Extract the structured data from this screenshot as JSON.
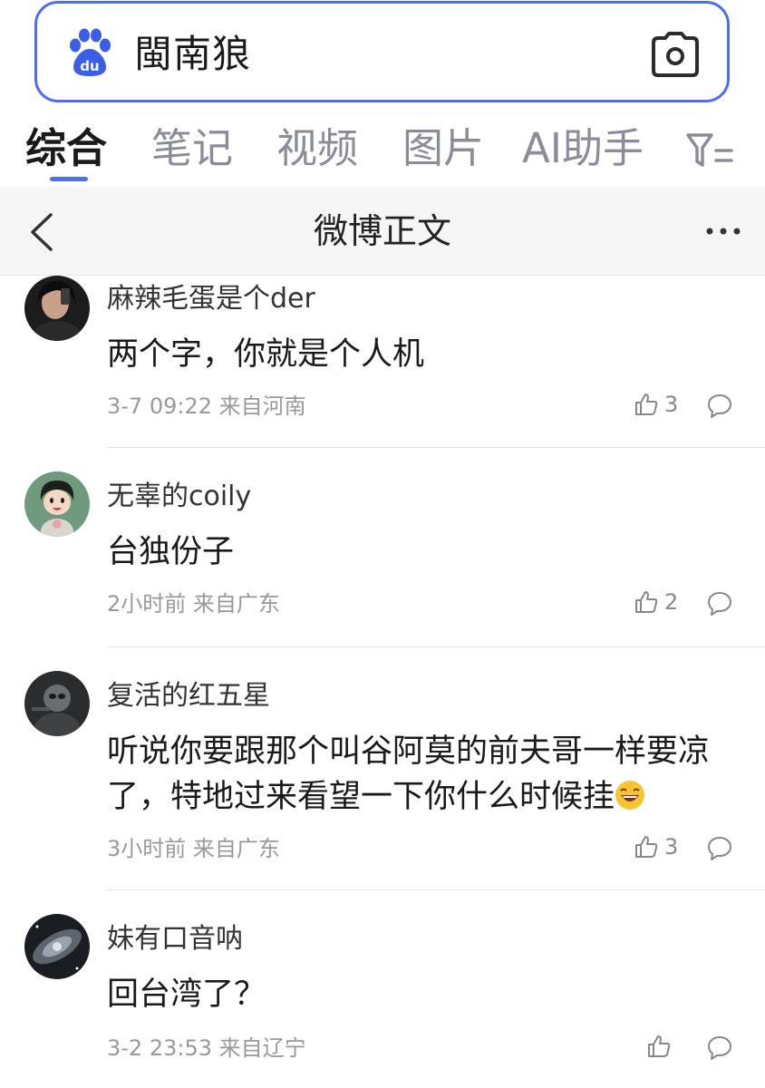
{
  "search": {
    "query": "閩南狼",
    "logo_icon": "baidu-paw-icon",
    "camera_icon": "camera-icon"
  },
  "tabs": [
    {
      "label": "综合",
      "active": true
    },
    {
      "label": "笔记",
      "active": false
    },
    {
      "label": "视频",
      "active": false
    },
    {
      "label": "图片",
      "active": false
    },
    {
      "label": "AI助手",
      "active": false
    }
  ],
  "header": {
    "title": "微博正文",
    "back_icon": "chevron-left-icon",
    "more_icon": "more-dots-icon"
  },
  "comments": [
    {
      "author": "麻辣毛蛋是个der",
      "text": "两个字，你就是个人机",
      "meta": "3-7 09:22 来自河南",
      "likes": "3"
    },
    {
      "author": "无辜的coily",
      "text": "台独份子",
      "meta": "2小时前 来自广东",
      "likes": "2"
    },
    {
      "author": "复活的红五星",
      "text": "听说你要跟那个叫谷阿莫的前夫哥一样要凉了，特地过来看望一下你什么时候挂",
      "meta": "3小时前 来自广东",
      "likes": "3",
      "emoji": "laughing-face-emoji"
    },
    {
      "author": "妹有口音呐",
      "text": "回台湾了？",
      "meta": "3-2 23:53 来自辽宁",
      "likes": ""
    }
  ],
  "colors": {
    "accent": "#4e6ef2",
    "muted_text": "#999999",
    "header_bg": "#f6f6f6"
  }
}
